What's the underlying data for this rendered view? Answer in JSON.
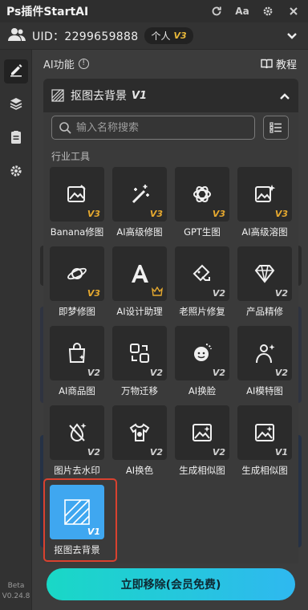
{
  "app": {
    "title": "Ps插件StartAI"
  },
  "user": {
    "uid_text": "UID：2299659888",
    "plan": "个人",
    "plan_level": "V3"
  },
  "section": {
    "title": "AI功能",
    "tutorial": "教程"
  },
  "dropdown": {
    "selected": "抠图去背景",
    "version": "V1"
  },
  "search": {
    "placeholder": "输入名称搜索"
  },
  "category": "行业工具",
  "tools": [
    {
      "name": "Banana修图",
      "version": "V3",
      "icon": "image-edit-icon"
    },
    {
      "name": "AI高级修图",
      "version": "V3",
      "icon": "magic-wand-icon"
    },
    {
      "name": "GPT生图",
      "version": "V3",
      "icon": "gpt-logo-icon"
    },
    {
      "name": "AI高级溶图",
      "version": "V3",
      "icon": "image-sparkle-icon"
    },
    {
      "name": "即梦修图",
      "version": "V3",
      "icon": "planet-icon"
    },
    {
      "name": "AI设计助理",
      "version": "",
      "icon": "design-a-icon"
    },
    {
      "name": "老照片修复",
      "version": "V2",
      "icon": "brush-repair-icon"
    },
    {
      "name": "产品精修",
      "version": "V2",
      "icon": "diamond-icon"
    },
    {
      "name": "AI商品图",
      "version": "V2",
      "icon": "shopping-bag-icon"
    },
    {
      "name": "万物迁移",
      "version": "V2",
      "icon": "transfer-icon"
    },
    {
      "name": "AI换脸",
      "version": "V2",
      "icon": "face-swap-icon"
    },
    {
      "name": "AI模特图",
      "version": "V2",
      "icon": "model-person-icon"
    },
    {
      "name": "图片去水印",
      "version": "V2",
      "icon": "no-watermark-icon"
    },
    {
      "name": "AI换色",
      "version": "V2",
      "icon": "recolor-shirt-icon"
    },
    {
      "name": "生成相似图",
      "version": "V2",
      "icon": "similar-image-icon"
    },
    {
      "name": "生成相似图",
      "version": "V1",
      "icon": "similar-image-icon"
    },
    {
      "name": "抠图去背景",
      "version": "V1",
      "icon": "cutout-icon"
    }
  ],
  "sidebar": {
    "version_label": "Beta",
    "version_number": "V0.24.8"
  },
  "cta": {
    "label": "立即移除(会员免费)"
  },
  "colors": {
    "accent": "#3fa7f0",
    "gold": "#e6a92f",
    "highlight": "#d9412f"
  }
}
